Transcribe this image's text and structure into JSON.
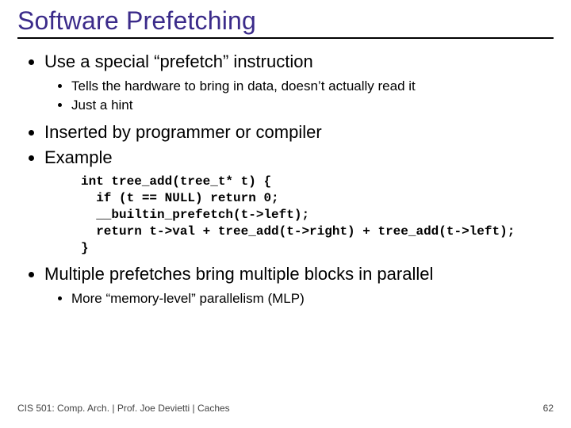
{
  "title": "Software Prefetching",
  "bullets": {
    "b1": "Use a special “prefetch” instruction",
    "b1_1": "Tells the hardware to bring in data, doesn’t actually read it",
    "b1_2": "Just a hint",
    "b2": "Inserted by programmer or compiler",
    "b3": "Example",
    "b4": "Multiple prefetches bring multiple blocks in parallel",
    "b4_1": "More “memory-level” parallelism (MLP)"
  },
  "code": {
    "l1": "int tree_add(tree_t* t) {",
    "l2": "  if (t == NULL) return 0;",
    "l3": "  __builtin_prefetch(t->left);",
    "l4": "  return t->val + tree_add(t->right) + tree_add(t->left);",
    "l5": "}"
  },
  "footer": {
    "left": "CIS 501: Comp. Arch.  |  Prof. Joe Devietti  |  Caches",
    "right": "62"
  }
}
